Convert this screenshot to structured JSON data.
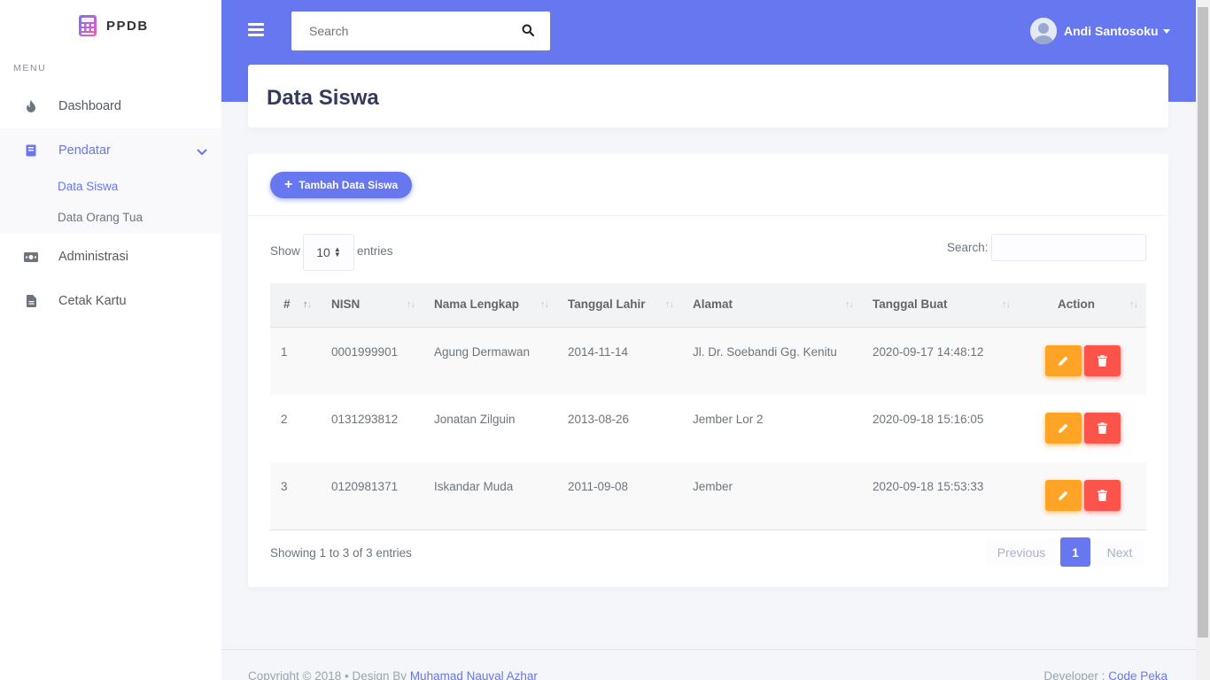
{
  "brand": {
    "name": "PPDB",
    "logo_icon": "calculator-icon"
  },
  "sidebar": {
    "menu_label": "MENU",
    "items": [
      {
        "label": "Dashboard",
        "icon": "fire-icon"
      },
      {
        "label": "Pendatar",
        "icon": "book-icon",
        "active": true,
        "expanded": true
      },
      {
        "label": "Administrasi",
        "icon": "money-icon"
      },
      {
        "label": "Cetak Kartu",
        "icon": "file-icon"
      }
    ],
    "submenu": [
      {
        "label": "Data Siswa",
        "active": true
      },
      {
        "label": "Data Orang Tua"
      }
    ]
  },
  "topbar": {
    "search_placeholder": "Search",
    "user_name": "Andi Santosoku"
  },
  "page": {
    "title": "Data Siswa"
  },
  "toolbar": {
    "add_label": "Tambah Data Siswa"
  },
  "table_controls": {
    "show_label": "Show",
    "entries_value": "10",
    "entries_label": "entries",
    "search_label": "Search:"
  },
  "table": {
    "headers": [
      "#",
      "NISN",
      "Nama Lengkap",
      "Tanggal Lahir",
      "Alamat",
      "Tanggal Buat",
      "Action"
    ],
    "rows": [
      {
        "no": "1",
        "nisn": "0001999901",
        "nama": "Agung Dermawan",
        "lahir": "2014-11-14",
        "alamat": "Jl. Dr. Soebandi Gg. Kenitu",
        "buat": "2020-09-17 14:48:12"
      },
      {
        "no": "2",
        "nisn": "0131293812",
        "nama": "Jonatan Zilguin",
        "lahir": "2013-08-26",
        "alamat": "Jember Lor 2",
        "buat": "2020-09-18 15:16:05"
      },
      {
        "no": "3",
        "nisn": "0120981371",
        "nama": "Iskandar Muda",
        "lahir": "2011-09-08",
        "alamat": "Jember",
        "buat": "2020-09-18 15:53:33"
      }
    ]
  },
  "pagination": {
    "info": "Showing 1 to 3 of 3 entries",
    "previous": "Previous",
    "current": "1",
    "next": "Next"
  },
  "footer": {
    "copyright": "Copyright © 2018",
    "design_by": "Design By",
    "designer": "Muhamad Nauval Azhar",
    "developer_label": "Developer :",
    "developer": "Code Peka"
  },
  "colors": {
    "primary": "#6777ef",
    "warning": "#ffa426",
    "danger": "#fc544b"
  }
}
